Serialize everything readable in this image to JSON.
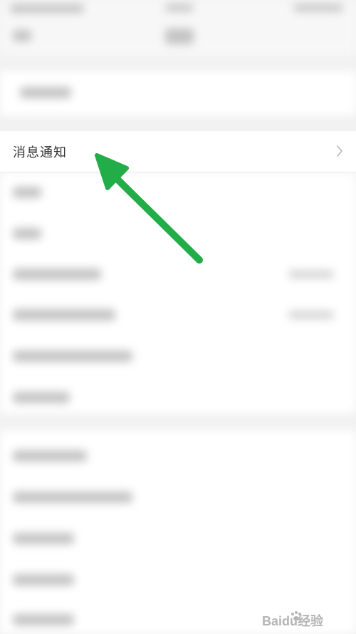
{
  "settings": {
    "notifications_label": "消息通知"
  },
  "annotation": {
    "arrow_color": "#22ad49"
  },
  "watermark": {
    "brand": "Baidu经验"
  },
  "icons": {
    "row_chevron": "chevron-right-icon",
    "watermark_paw": "paw-icon"
  }
}
